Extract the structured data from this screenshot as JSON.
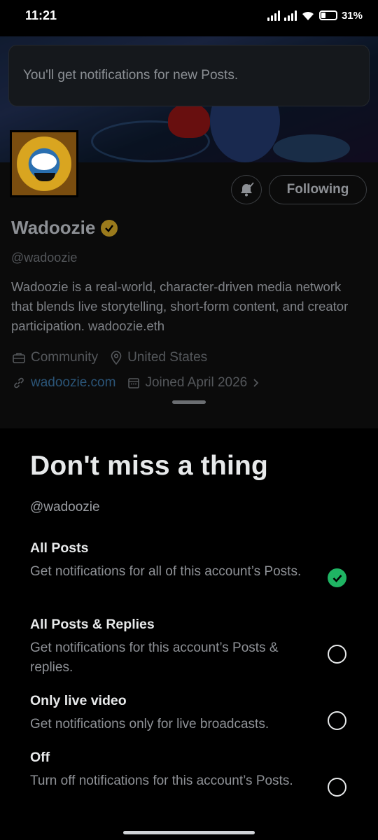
{
  "status_bar": {
    "time": "11:21",
    "battery": "31%"
  },
  "toast": {
    "text": "You'll get notifications for new Posts."
  },
  "profile": {
    "following_label": "Following",
    "name": "Wadoozie",
    "handle": "@wadoozie",
    "bio": "Wadoozie is a real-world, character-driven media network that blends live storytelling, short-form content, and creator participation. wadoozie.eth",
    "category": "Community",
    "location": "United States",
    "website": "wadoozie.com",
    "joined": "Joined April 2026"
  },
  "sheet": {
    "title": "Don't miss a thing",
    "handle": "@wadoozie",
    "options": [
      {
        "title": "All Posts",
        "desc": "Get notifications for all of this account’s Posts.",
        "selected": true
      },
      {
        "title": "All Posts & Replies",
        "desc": "Get notifications for this account’s Posts & replies.",
        "selected": false
      },
      {
        "title": "Only live video",
        "desc": "Get notifications only for live broadcasts.",
        "selected": false
      },
      {
        "title": "Off",
        "desc": "Turn off notifications for this account’s Posts.",
        "selected": false
      }
    ]
  },
  "colors": {
    "accent_green": "#1fb463",
    "verified_gold": "#9a7a1c",
    "link_blue": "#2b5578"
  }
}
